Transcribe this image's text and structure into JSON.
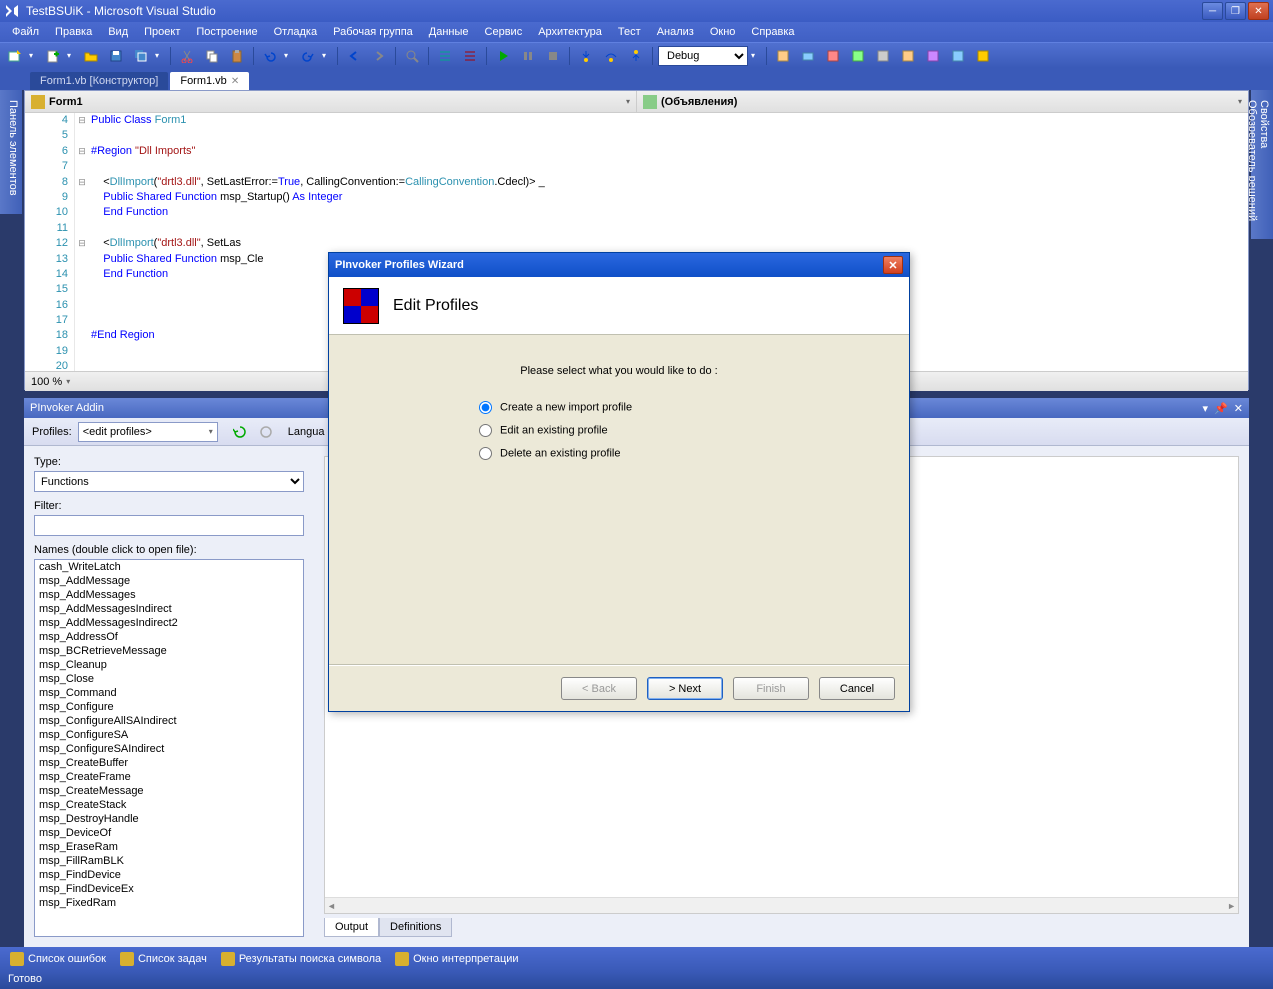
{
  "titlebar": {
    "title": "TestBSUiK - Microsoft Visual Studio"
  },
  "menu": [
    "Файл",
    "Правка",
    "Вид",
    "Проект",
    "Построение",
    "Отладка",
    "Рабочая группа",
    "Данные",
    "Сервис",
    "Архитектура",
    "Тест",
    "Анализ",
    "Окно",
    "Справка"
  ],
  "toolbar2": {
    "config": "Debug"
  },
  "tabs": [
    {
      "label": "Form1.vb [Конструктор]",
      "active": false
    },
    {
      "label": "Form1.vb",
      "active": true
    }
  ],
  "editor": {
    "left_dd": "Form1",
    "right_dd": "(Объявления)",
    "zoom": "100 %",
    "lines": [
      4,
      5,
      6,
      7,
      8,
      9,
      10,
      11,
      12,
      13,
      14,
      15,
      16,
      17,
      18,
      19,
      20
    ]
  },
  "side": {
    "left": "Панель элементов",
    "right1": "Свойства",
    "right2": "Обозреватель решений"
  },
  "pinvoker": {
    "title": "PInvoker Addin",
    "profiles_label": "Profiles:",
    "profiles_value": "<edit profiles>",
    "language_label": "Langua",
    "type_label": "Type:",
    "type_value": "Functions",
    "filter_label": "Filter:",
    "names_label": "Names (double click to open file):",
    "output_tab": "Output",
    "def_tab": "Definitions",
    "names": [
      "cash_WriteLatch",
      "msp_AddMessage",
      "msp_AddMessages",
      "msp_AddMessagesIndirect",
      "msp_AddMessagesIndirect2",
      "msp_AddressOf",
      "msp_BCRetrieveMessage",
      "msp_Cleanup",
      "msp_Close",
      "msp_Command",
      "msp_Configure",
      "msp_ConfigureAllSAIndirect",
      "msp_ConfigureSA",
      "msp_ConfigureSAIndirect",
      "msp_CreateBuffer",
      "msp_CreateFrame",
      "msp_CreateMessage",
      "msp_CreateStack",
      "msp_DestroyHandle",
      "msp_DeviceOf",
      "msp_EraseRam",
      "msp_FillRamBLK",
      "msp_FindDevice",
      "msp_FindDeviceEx",
      "msp_FixedRam"
    ]
  },
  "links": [
    "Список ошибок",
    "Список задач",
    "Результаты поиска символа",
    "Окно интерпретации"
  ],
  "status": "Готово",
  "wizard": {
    "title": "PInvoker Profiles Wizard",
    "heading": "Edit Profiles",
    "prompt": "Please select what you would like to do :",
    "opt1": "Create a new import profile",
    "opt2": "Edit an existing profile",
    "opt3": "Delete an existing profile",
    "back": "< Back",
    "next": "> Next",
    "finish": "Finish",
    "cancel": "Cancel"
  }
}
